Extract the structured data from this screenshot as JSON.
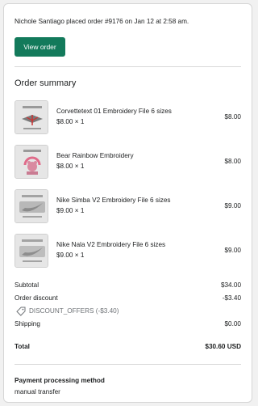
{
  "header": {
    "notice": "Nichole Santiago placed order #9176 on Jan 12 at 2:58 am.",
    "view_order_label": "View order"
  },
  "summary": {
    "title": "Order summary",
    "items": [
      {
        "name": "Corvettetext 01 Embroidery File 6 sizes",
        "qty": "$8.00 × 1",
        "total": "$8.00",
        "thumb_icon": "corvette-logo-image"
      },
      {
        "name": "Bear Rainbow Embroidery",
        "qty": "$8.00 × 1",
        "total": "$8.00",
        "thumb_icon": "bear-rainbow-image"
      },
      {
        "name": "Nike Simba V2 Embroidery File 6 sizes",
        "qty": "$9.00 × 1",
        "total": "$9.00",
        "thumb_icon": "nike-simba-image"
      },
      {
        "name": "Nike Nala V2 Embroidery File 6 sizes",
        "qty": "$9.00 × 1",
        "total": "$9.00",
        "thumb_icon": "nike-nala-image"
      }
    ],
    "subtotal_label": "Subtotal",
    "subtotal_value": "$34.00",
    "discount_label": "Order discount",
    "discount_value": "-$3.40",
    "discount_code": "DISCOUNT_OFFERS (-$3.40)",
    "shipping_label": "Shipping",
    "shipping_value": "$0.00",
    "total_label": "Total",
    "total_value": "$30.60 USD"
  },
  "payment": {
    "title": "Payment processing method",
    "method": "manual transfer"
  },
  "colors": {
    "accent": "#137a5b",
    "card_border": "#d6d6d6",
    "muted_text": "#6d7175"
  }
}
